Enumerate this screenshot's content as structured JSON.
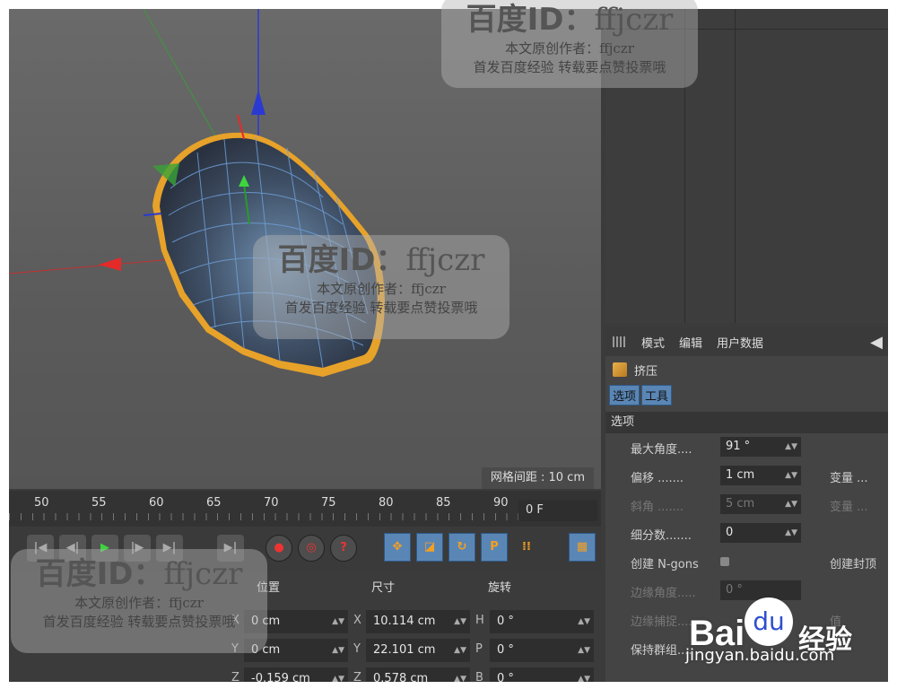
{
  "viewport": {
    "grid_readout": "网格间距 : 10 cm"
  },
  "attr": {
    "menu": [
      "模式",
      "编辑",
      "用户数据"
    ],
    "object_name": "挤压",
    "tabs": [
      "选项",
      "工具"
    ],
    "section": "选项",
    "rows": [
      {
        "label": "最大角度....",
        "value": "91 °",
        "right": ""
      },
      {
        "label": "偏移 .......",
        "value": "1 cm",
        "right": "变量 ..."
      },
      {
        "label": "斜角 .......",
        "value": "5 cm",
        "right": "变量 ..."
      },
      {
        "label": "细分数.......",
        "value": "0",
        "right": ""
      },
      {
        "label": "创建 N-gons",
        "value": "",
        "right": "创建封顶"
      },
      {
        "label": "边缘角度.....",
        "value": "0 °",
        "right": ""
      },
      {
        "label": "边缘捕捉....",
        "value": "",
        "right": "值"
      },
      {
        "label": "保持群组....",
        "value": "",
        "right": ""
      }
    ]
  },
  "timeline": {
    "ticks": [
      "50",
      "55",
      "60",
      "65",
      "70",
      "75",
      "80",
      "85",
      "90"
    ],
    "frame_value": "0 F"
  },
  "coords": {
    "headers": {
      "position": "位置",
      "size": "尺寸",
      "rotation": "旋转"
    },
    "rows": [
      {
        "axis": "X",
        "pos": "0 cm",
        "size_axis": "X",
        "size": "10.114 cm",
        "rot_axis": "H",
        "rot": "0 °"
      },
      {
        "axis": "Y",
        "pos": "0 cm",
        "size_axis": "Y",
        "size": "22.101 cm",
        "rot_axis": "P",
        "rot": "0 °"
      },
      {
        "axis": "Z",
        "pos": "-0.159 cm",
        "size_axis": "Z",
        "size": "0.578 cm",
        "rot_axis": "B",
        "rot": "0 °"
      }
    ]
  },
  "watermark": {
    "id_label": "百度ID：",
    "id_name": "ffjczr",
    "line1": "本文原创作者：ffjczr",
    "line2": "首发百度经验 转载要点赞投票哦"
  },
  "baidu": {
    "logo": "Bai",
    "paw": "du",
    "jingyan": "经验",
    "url": "jingyan.baidu.com"
  },
  "colors": {
    "accent_blue": "#5a86b5",
    "selection_orange": "#f5a020"
  }
}
